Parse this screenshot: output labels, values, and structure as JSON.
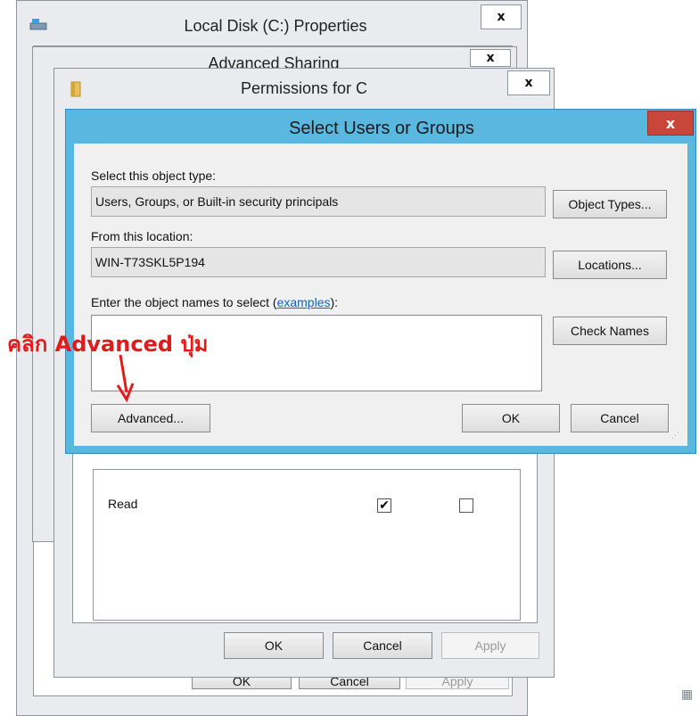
{
  "windows": {
    "local_disk": {
      "title": "Local Disk (C:) Properties",
      "close": "x",
      "buttons": {
        "ok": "OK",
        "cancel": "Cancel",
        "apply": "Apply"
      }
    },
    "advanced_sharing": {
      "title": "Advanced Sharing",
      "close": "x"
    },
    "permissions": {
      "title": "Permissions for C",
      "close": "x",
      "perm_row_label": "Read",
      "perm_row_allow": true,
      "perm_row_deny": false,
      "buttons": {
        "ok": "OK",
        "cancel": "Cancel",
        "apply": "Apply"
      }
    }
  },
  "select_users": {
    "title": "Select Users or Groups",
    "close": "x",
    "object_type_label": "Select this object type:",
    "object_type_value": "Users, Groups, or Built-in security principals",
    "object_types_button": "Object Types...",
    "location_label": "From this location:",
    "location_value": "WIN-T73SKL5P194",
    "locations_button": "Locations...",
    "enter_label": "Enter the object names to select (",
    "examples_link": "examples",
    "enter_label_end": "):",
    "check_names_button": "Check Names",
    "advanced_button": "Advanced...",
    "ok_button": "OK",
    "cancel_button": "Cancel",
    "object_names_value": ""
  },
  "annotation": {
    "text_prefix": "คลิก ",
    "text_bold": "Advanced",
    "text_suffix": " ปุ่ม",
    "color": "#e11b1b"
  }
}
